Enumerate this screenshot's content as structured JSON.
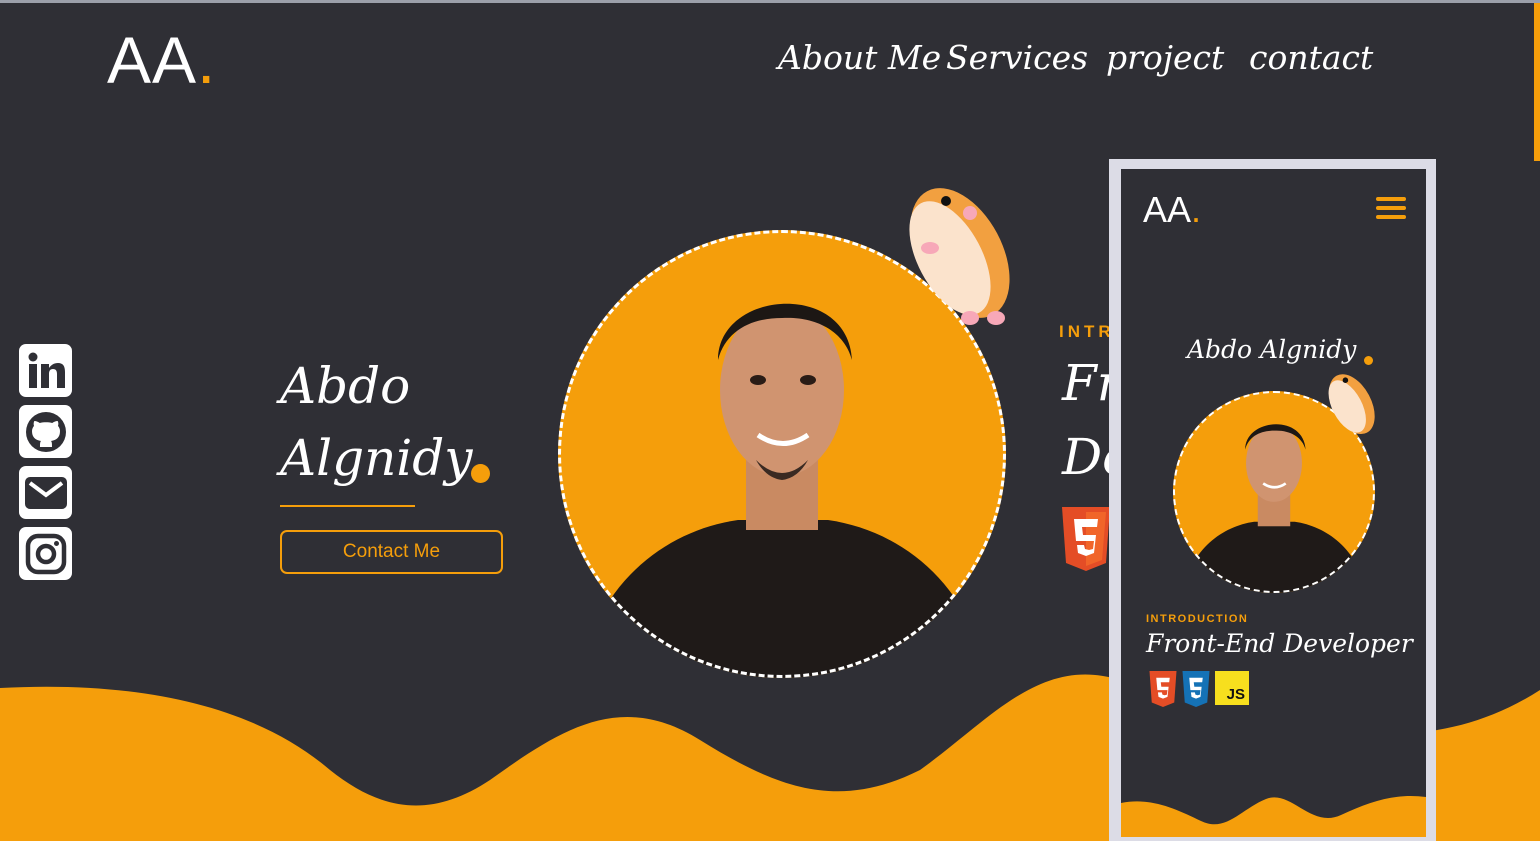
{
  "header": {
    "logo_text": "AA",
    "logo_dot": ".",
    "nav": [
      {
        "label": "About Me"
      },
      {
        "label": "Services"
      },
      {
        "label": "project"
      },
      {
        "label": "contact"
      }
    ]
  },
  "social": [
    {
      "icon": "linkedin-icon"
    },
    {
      "icon": "github-icon"
    },
    {
      "icon": "mail-icon"
    },
    {
      "icon": "instagram-icon"
    }
  ],
  "hero": {
    "first_name": "Abdo",
    "last_name": "Algnidy",
    "contact_button": "Contact Me"
  },
  "intro": {
    "label": "INTR",
    "title_line1": "Fr",
    "title_line2": "De"
  },
  "mobile": {
    "logo_text": "AA",
    "logo_dot": ".",
    "name": "Abdo Algnidy",
    "intro_label": "INTRODUCTION",
    "title": "Front-End Developer",
    "badges": [
      "html5-icon",
      "css3-icon",
      "js-icon"
    ],
    "badge_js": "JS"
  },
  "colors": {
    "background": "#2f2f35",
    "accent": "#f59e0b",
    "text": "#ffffff",
    "frame": "#dcdce6"
  }
}
